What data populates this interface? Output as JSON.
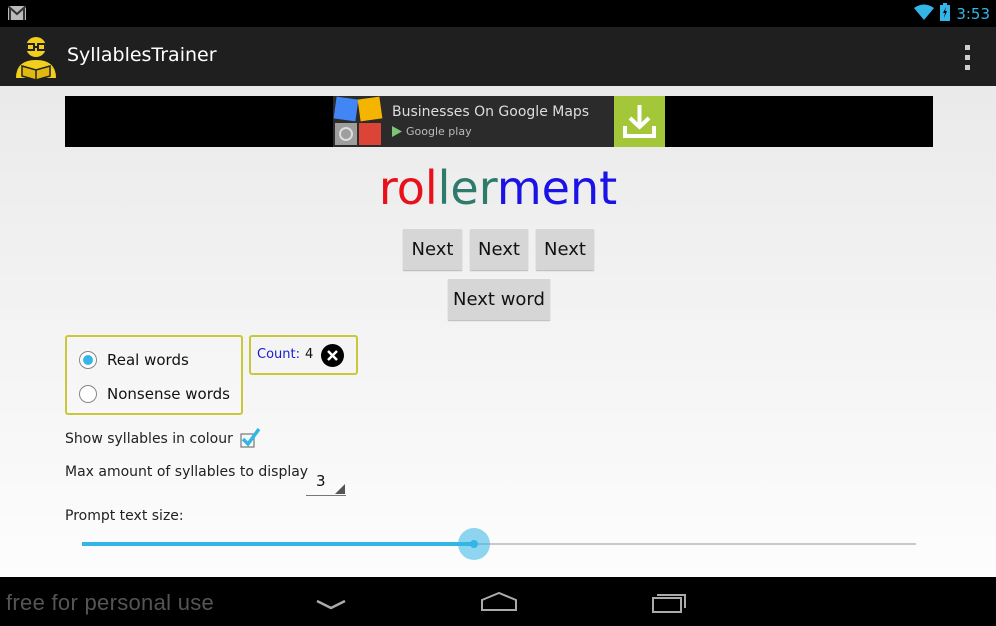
{
  "status_bar": {
    "time": "3:53",
    "icons": [
      "gmail-icon",
      "wifi-icon",
      "battery-icon"
    ]
  },
  "action_bar": {
    "title": "SyllablesTrainer",
    "icons": [
      "app-icon",
      "overflow-menu-icon"
    ]
  },
  "ad": {
    "title": "Businesses On Google Maps",
    "store": "Google play",
    "colors": {
      "download_bg": "#a4c639"
    }
  },
  "word": {
    "syllables": [
      {
        "text": "rol",
        "color": "#e8101a"
      },
      {
        "text": "ler",
        "color": "#2e7b6c"
      },
      {
        "text": "ment",
        "color": "#1a12e6"
      }
    ]
  },
  "buttons": {
    "next_1": "Next",
    "next_2": "Next",
    "next_3": "Next",
    "next_word": "Next word"
  },
  "word_type": {
    "options": [
      {
        "label": "Real words",
        "selected": true
      },
      {
        "label": "Nonsense words",
        "selected": false
      }
    ]
  },
  "count": {
    "label": "Count:",
    "value": "4"
  },
  "settings": {
    "show_colour_label": "Show syllables in colour",
    "show_colour_checked": true,
    "max_syllables_label": "Max amount of syllables to display",
    "max_syllables_value": "3",
    "prompt_size_label": "Prompt text size:",
    "prompt_size_fraction": 0.47
  },
  "nav_bar": {
    "watermark": "free for personal use",
    "icons": [
      "back-icon",
      "home-icon",
      "recent-apps-icon"
    ]
  },
  "colors": {
    "accent": "#33b5e5",
    "group_border": "#c8c83a"
  }
}
